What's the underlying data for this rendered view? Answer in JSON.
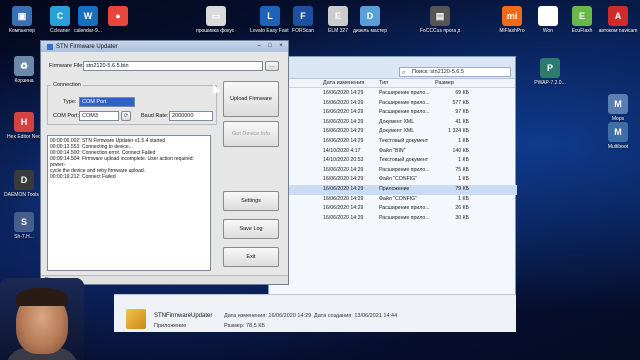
{
  "desktop_icons": [
    {
      "label": "Компьютер",
      "color": "#3b6fb3",
      "glyph": "▣"
    },
    {
      "label": "Ccleaner",
      "color": "#2aa0d8",
      "glyph": "C"
    },
    {
      "label": "calendar-9...",
      "color": "#1a6fbd",
      "glyph": "W"
    },
    {
      "label": "",
      "color": "#e8453c",
      "glyph": "●"
    },
    {
      "label": "прошивка фокус 3",
      "color": "#d9d9d9",
      "glyph": "▭"
    },
    {
      "label": "Lovato Easy Fast 5",
      "color": "#1d63b6",
      "glyph": "L"
    },
    {
      "label": "FORScan",
      "color": "#1f4fa0",
      "glyph": "F"
    },
    {
      "label": "ELM 327",
      "color": "#cccccc",
      "glyph": "E"
    },
    {
      "label": "дизель мастер",
      "color": "#5aa0d8",
      "glyph": "D"
    },
    {
      "label": "FoCCCus прога д...",
      "color": "#555555",
      "glyph": "▤"
    },
    {
      "label": "MiFlashPro",
      "color": "#f06a1c",
      "glyph": "mi"
    },
    {
      "label": "Won",
      "color": "#ffffff",
      "glyph": "☺"
    },
    {
      "label": "EcuFlash",
      "color": "#6bb84a",
      "glyph": "E"
    },
    {
      "label": "автоком navicam",
      "color": "#d02b2b",
      "glyph": "A"
    },
    {
      "label": "Корзина",
      "color": "#6d88a8",
      "glyph": "♻"
    },
    {
      "label": "Hex Editor Neo",
      "color": "#d54040",
      "glyph": "H"
    },
    {
      "label": "DAEMON Tools Lite",
      "color": "#3a3a3a",
      "glyph": "D"
    },
    {
      "label": "Sh-7.Н...",
      "color": "#44608a",
      "glyph": "S"
    },
    {
      "label": "PWAP-7.2.0...",
      "color": "#2d7a6f",
      "glyph": "P"
    },
    {
      "label": "Mops",
      "color": "#5a7eb0",
      "glyph": "M"
    },
    {
      "label": "Multiboot",
      "color": "#3d6fa6",
      "glyph": "M"
    }
  ],
  "explorer": {
    "search_placeholder": "Поиск: stn2120-5.6.5",
    "columns": [
      "Дата изменения",
      "Тип",
      "Размер"
    ],
    "rows": [
      {
        "date": "16/06/2020 14:29",
        "type": "Расширение прило...",
        "size": "69 КБ",
        "highlight": false
      },
      {
        "date": "16/06/2020 14:29",
        "type": "Расширение прило...",
        "size": "577 КБ",
        "highlight": false
      },
      {
        "date": "16/06/2020 14:29",
        "type": "Расширение прило...",
        "size": "97 КБ",
        "highlight": false
      },
      {
        "date": "16/06/2020 14:29",
        "type": "Документ XML",
        "size": "41 КБ",
        "highlight": false
      },
      {
        "date": "16/06/2020 14:29",
        "type": "Документ XML",
        "size": "1 324 КБ",
        "highlight": false
      },
      {
        "date": "16/06/2020 14:29",
        "type": "Текстовый документ",
        "size": "1 КБ",
        "highlight": false
      },
      {
        "date": "14/10/2020 4:17",
        "type": "Файл \"BIN\"",
        "size": "140 КБ",
        "highlight": false
      },
      {
        "date": "14/10/2020 20:53",
        "type": "Текстовый документ",
        "size": "1 КБ",
        "highlight": false
      },
      {
        "date": "16/06/2020 14:29",
        "type": "Расширение прило...",
        "size": "75 КБ",
        "highlight": false
      },
      {
        "date": "16/06/2020 14:29",
        "type": "Файл \"CONFIG\"",
        "size": "1 КБ",
        "highlight": false
      },
      {
        "date": "16/06/2020 14:29",
        "type": "Приложение",
        "size": "79 КБ",
        "highlight": true
      },
      {
        "date": "16/06/2020 14:29",
        "type": "Файл \"CONFIG\"",
        "size": "1 КБ",
        "highlight": false
      },
      {
        "date": "16/06/2020 14:29",
        "type": "Расширение прило...",
        "size": "26 КБ",
        "highlight": false
      },
      {
        "date": "16/06/2020 14:29",
        "type": "Расширение прило...",
        "size": "30 КБ",
        "highlight": false
      }
    ],
    "details": {
      "name": "STNFirmwareUpdater",
      "type": "Приложение",
      "modified": "Дата изменения: 16/06/2020 14:29",
      "size": "Размер: 78,5 КБ",
      "created": "Дата создания: 13/06/2021 14:44"
    }
  },
  "updater": {
    "title": "STN Firmware Updater",
    "firmware_label": "Firmware File:",
    "firmware_value": "stn2120-5.6.5.bin",
    "browse_label": "...",
    "connection_label": "Connection",
    "type_label": "Type:",
    "type_value": "COM Port",
    "com_port_label": "COM Port:",
    "com_port_value": "COM3",
    "baud_label": "Baud Rate:",
    "baud_value": "2000000",
    "buttons": {
      "upload": "Upload Firmware",
      "get_info": "Get Device Info",
      "settings": "Settings",
      "save_log": "Save Log",
      "exit": "Exit"
    },
    "log_lines": [
      "00:00:00.002: STN Firmware Updater v1.5.4 started",
      "00:00:13.553: Connecting to device...",
      "00:00:14.500: Connection error. Connect Failed",
      "00:00:14.504: Firmware upload incomplete. User action required: power-",
      "cycle the device and retry firmware upload.",
      "00:00:19.212: Connect Failed"
    ],
    "status": "Error"
  }
}
